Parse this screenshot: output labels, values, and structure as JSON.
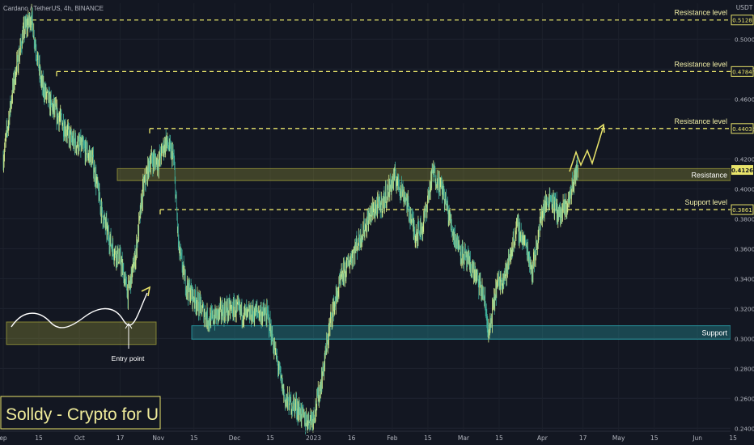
{
  "header": {
    "symbol_text": "Cardano / TetherUS, 4h, BINANCE",
    "currency": "USDT"
  },
  "watermark": "Solldy - Crypto for U",
  "colors": {
    "background": "#131722",
    "candle_up": "#cfe78a",
    "candle_down": "#3fae9b",
    "level_line": "#e8e36a",
    "resistance_zone": "#9a9a3a",
    "support_zone": "#2aa7b0",
    "current_price_tag": "#e8e36a"
  },
  "chart_data": {
    "type": "candlestick",
    "y_axis": {
      "min": 0.238,
      "max": 0.524,
      "ticks": [
        "0.5000",
        "0.4800",
        "0.4600",
        "0.4400",
        "0.4200",
        "0.4000",
        "0.3800",
        "0.3600",
        "0.3400",
        "0.3200",
        "0.3000",
        "0.2800",
        "0.2600",
        "0.2400"
      ],
      "unit": "USDT"
    },
    "x_axis": {
      "range": [
        "2022-09-01",
        "2023-06-14"
      ],
      "ticks": [
        {
          "label": "ep",
          "date": "2022-09-01"
        },
        {
          "label": "15",
          "date": "2022-09-15"
        },
        {
          "label": "Oct",
          "date": "2022-10-01"
        },
        {
          "label": "17",
          "date": "2022-10-17"
        },
        {
          "label": "Nov",
          "date": "2022-11-01"
        },
        {
          "label": "15",
          "date": "2022-11-15"
        },
        {
          "label": "Dec",
          "date": "2022-12-01"
        },
        {
          "label": "15",
          "date": "2022-12-15"
        },
        {
          "label": "2023",
          "date": "2023-01-01"
        },
        {
          "label": "16",
          "date": "2023-01-16"
        },
        {
          "label": "Feb",
          "date": "2023-02-01"
        },
        {
          "label": "15",
          "date": "2023-02-15"
        },
        {
          "label": "Mar",
          "date": "2023-03-01"
        },
        {
          "label": "15",
          "date": "2023-03-15"
        },
        {
          "label": "Apr",
          "date": "2023-04-01"
        },
        {
          "label": "17",
          "date": "2023-04-17"
        },
        {
          "label": "May",
          "date": "2023-05-01"
        },
        {
          "label": "15",
          "date": "2023-05-15"
        },
        {
          "label": "Jun",
          "date": "2023-06-01"
        },
        {
          "label": "15",
          "date": "2023-06-15"
        }
      ]
    },
    "price_path": [
      [
        "2022-09-01",
        0.42
      ],
      [
        "2022-09-05",
        0.47
      ],
      [
        "2022-09-09",
        0.505
      ],
      [
        "2022-09-12",
        0.515
      ],
      [
        "2022-09-16",
        0.47
      ],
      [
        "2022-09-20",
        0.455
      ],
      [
        "2022-09-24",
        0.445
      ],
      [
        "2022-09-28",
        0.432
      ],
      [
        "2022-10-02",
        0.428
      ],
      [
        "2022-10-06",
        0.42
      ],
      [
        "2022-10-10",
        0.382
      ],
      [
        "2022-10-14",
        0.36
      ],
      [
        "2022-10-17",
        0.353
      ],
      [
        "2022-10-20",
        0.33
      ],
      [
        "2022-10-23",
        0.355
      ],
      [
        "2022-10-26",
        0.4
      ],
      [
        "2022-10-29",
        0.42
      ],
      [
        "2022-11-01",
        0.418
      ],
      [
        "2022-11-04",
        0.432
      ],
      [
        "2022-11-07",
        0.42
      ],
      [
        "2022-11-09",
        0.36
      ],
      [
        "2022-11-12",
        0.335
      ],
      [
        "2022-11-16",
        0.325
      ],
      [
        "2022-11-21",
        0.312
      ],
      [
        "2022-11-26",
        0.318
      ],
      [
        "2022-12-01",
        0.32
      ],
      [
        "2022-12-06",
        0.315
      ],
      [
        "2022-12-10",
        0.318
      ],
      [
        "2022-12-14",
        0.315
      ],
      [
        "2022-12-17",
        0.29
      ],
      [
        "2022-12-21",
        0.258
      ],
      [
        "2022-12-25",
        0.255
      ],
      [
        "2022-12-29",
        0.245
      ],
      [
        "2023-01-01",
        0.248
      ],
      [
        "2023-01-04",
        0.27
      ],
      [
        "2023-01-08",
        0.315
      ],
      [
        "2023-01-12",
        0.34
      ],
      [
        "2023-01-16",
        0.355
      ],
      [
        "2023-01-20",
        0.37
      ],
      [
        "2023-01-24",
        0.385
      ],
      [
        "2023-01-28",
        0.39
      ],
      [
        "2023-02-02",
        0.408
      ],
      [
        "2023-02-06",
        0.395
      ],
      [
        "2023-02-10",
        0.37
      ],
      [
        "2023-02-13",
        0.375
      ],
      [
        "2023-02-17",
        0.412
      ],
      [
        "2023-02-21",
        0.398
      ],
      [
        "2023-02-25",
        0.37
      ],
      [
        "2023-03-01",
        0.355
      ],
      [
        "2023-03-05",
        0.345
      ],
      [
        "2023-03-09",
        0.328
      ],
      [
        "2023-03-11",
        0.302
      ],
      [
        "2023-03-14",
        0.335
      ],
      [
        "2023-03-18",
        0.345
      ],
      [
        "2023-03-22",
        0.375
      ],
      [
        "2023-03-26",
        0.36
      ],
      [
        "2023-03-28",
        0.345
      ],
      [
        "2023-04-01",
        0.385
      ],
      [
        "2023-04-04",
        0.395
      ],
      [
        "2023-04-08",
        0.382
      ],
      [
        "2023-04-11",
        0.39
      ],
      [
        "2023-04-14",
        0.41
      ],
      [
        "2023-04-15",
        0.4126
      ]
    ],
    "horizontal_levels": [
      {
        "label": "Resistance level",
        "value": 0.5128,
        "tag": "0.5128"
      },
      {
        "label": "Resistance level",
        "value": 0.4784,
        "tag": "0.4784"
      },
      {
        "label": "Resistance level",
        "value": 0.4403,
        "tag": "0.4403"
      },
      {
        "label": "Support level",
        "value": 0.3861,
        "tag": "0.3861"
      }
    ],
    "zones": [
      {
        "label": "Resistance",
        "low": 0.4055,
        "high": 0.4135
      },
      {
        "label": "Support",
        "low": 0.2995,
        "high": 0.3085
      },
      {
        "label": "",
        "low": 0.296,
        "high": 0.311
      }
    ],
    "current_price": 0.4126,
    "annotations": [
      {
        "text": "Entry point"
      }
    ]
  }
}
